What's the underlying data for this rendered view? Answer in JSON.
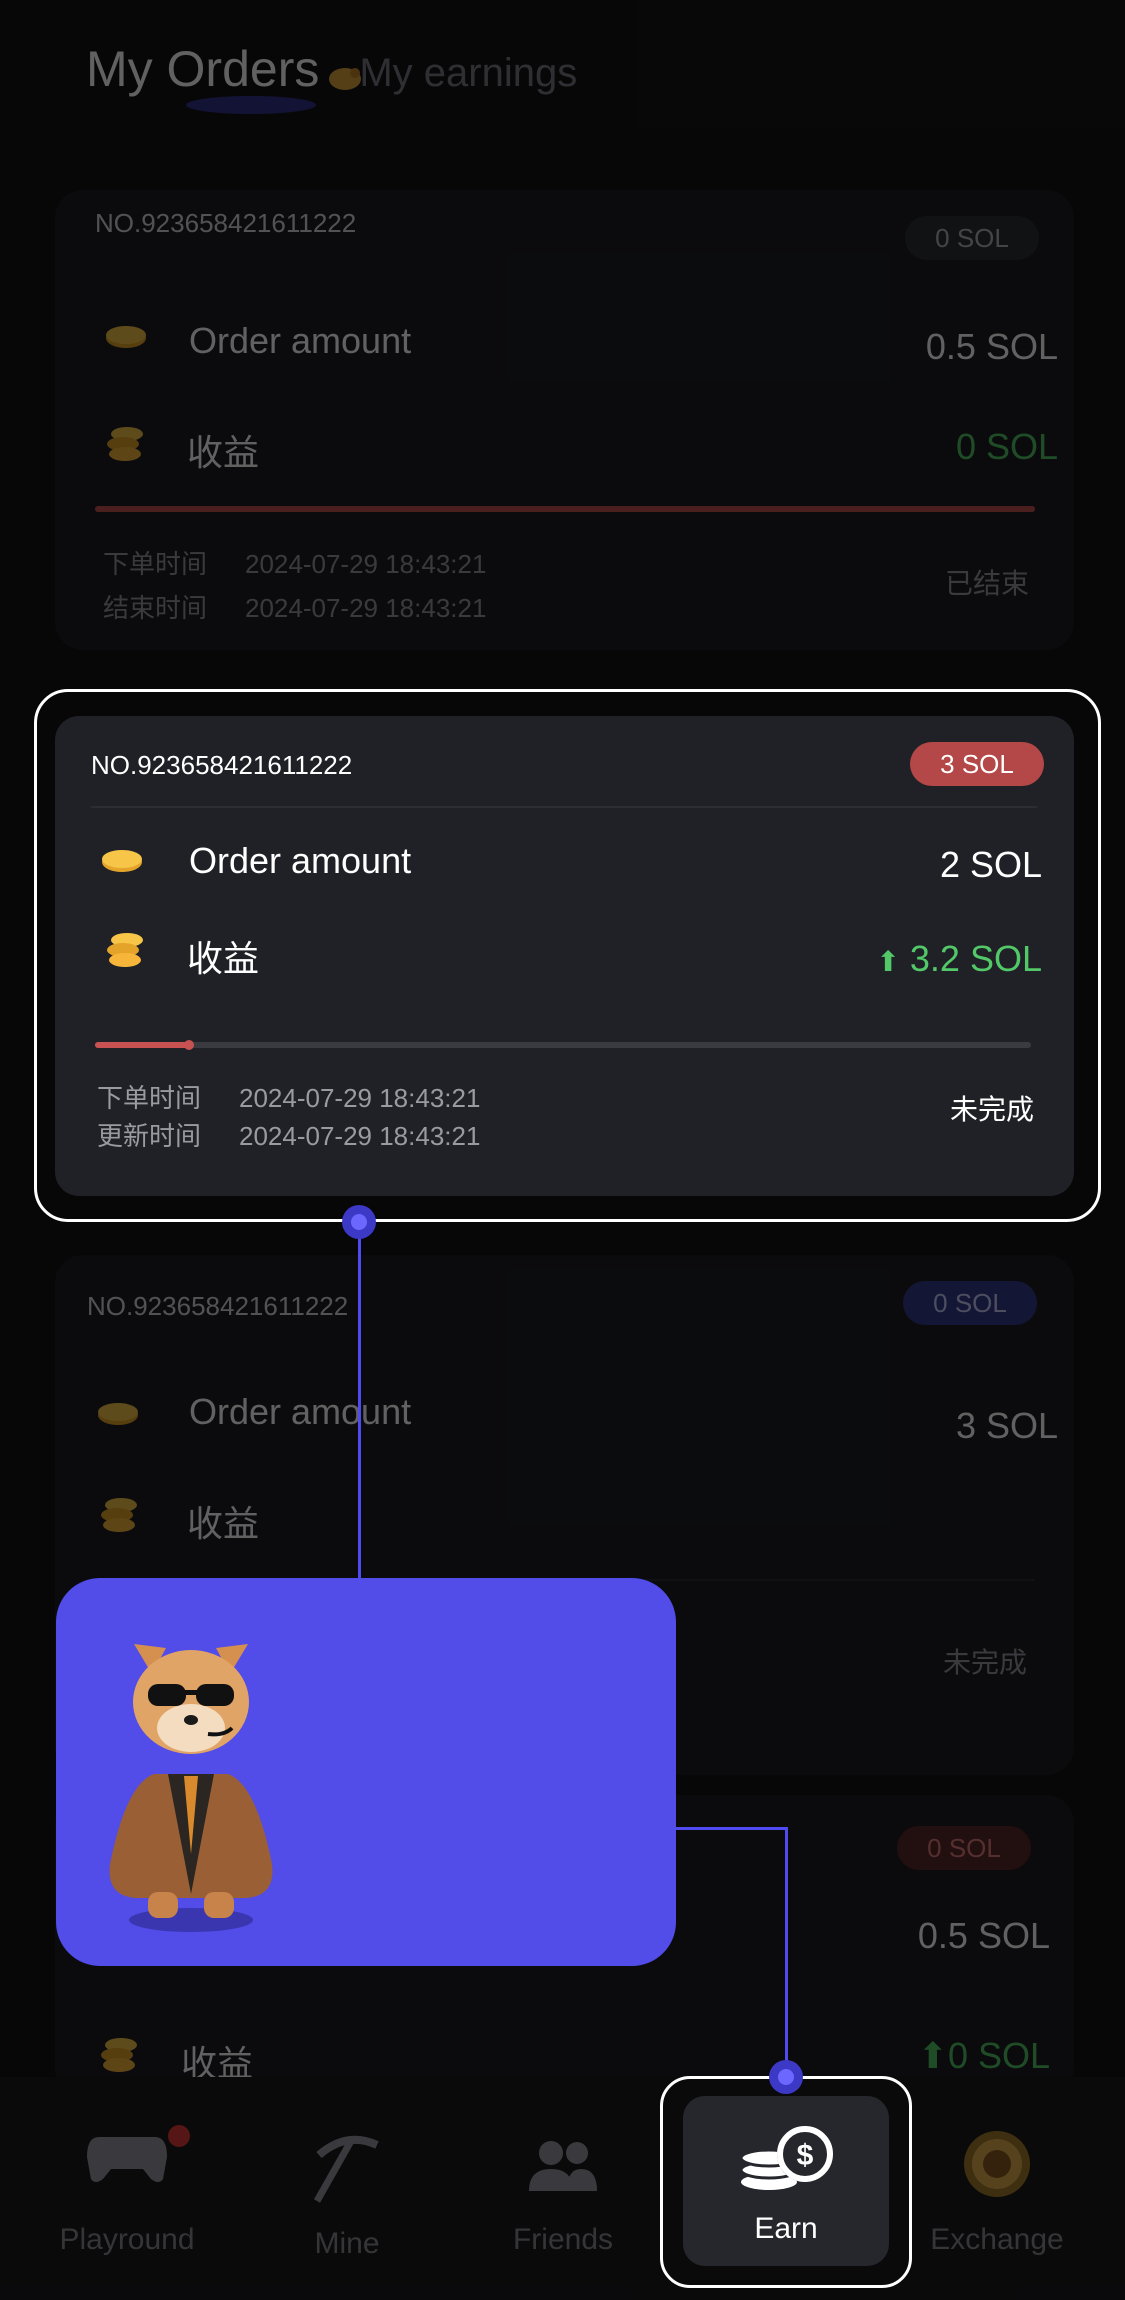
{
  "header": {
    "tab_active": "My Orders",
    "tab_inactive": "My earnings"
  },
  "orders": [
    {
      "order_no": "NO.923658421611222",
      "badge": "0 SOL",
      "amount_label": "Order amount",
      "amount_value": "0.5 SOL",
      "earnings_label": "收益",
      "earnings_value": "0 SOL",
      "progress": 1.0,
      "order_time_label": "下单时间",
      "order_time": "2024-07-29 18:43:21",
      "end_time_label": "结束时间",
      "end_time": "2024-07-29 18:43:21",
      "status": "已结束"
    },
    {
      "order_no": "NO.923658421611222",
      "badge": "3 SOL",
      "amount_label": "Order amount",
      "amount_value": "2 SOL",
      "earnings_label": "收益",
      "earnings_value": "3.2 SOL",
      "progress": 0.1,
      "order_time_label": "下单时间",
      "order_time": "2024-07-29 18:43:21",
      "update_time_label": "更新时间",
      "update_time": "2024-07-29 18:43:21",
      "status": "未完成"
    },
    {
      "order_no": "NO.923658421611222",
      "badge": "0 SOL",
      "amount_label": "Order amount",
      "amount_value": "3 SOL",
      "earnings_label": "收益",
      "status": "未完成"
    },
    {
      "badge": "0 SOL",
      "amount_value": "0.5 SOL",
      "earnings_label": "收益",
      "earnings_value": "0 SOL"
    }
  ],
  "nav": {
    "items": [
      "Playround",
      "Mine",
      "Friends",
      "Earn",
      "Exchange"
    ],
    "active": "Earn"
  },
  "colors": {
    "accent": "#524ce8",
    "up_green": "#52c868",
    "badge_red": "#b44747"
  }
}
